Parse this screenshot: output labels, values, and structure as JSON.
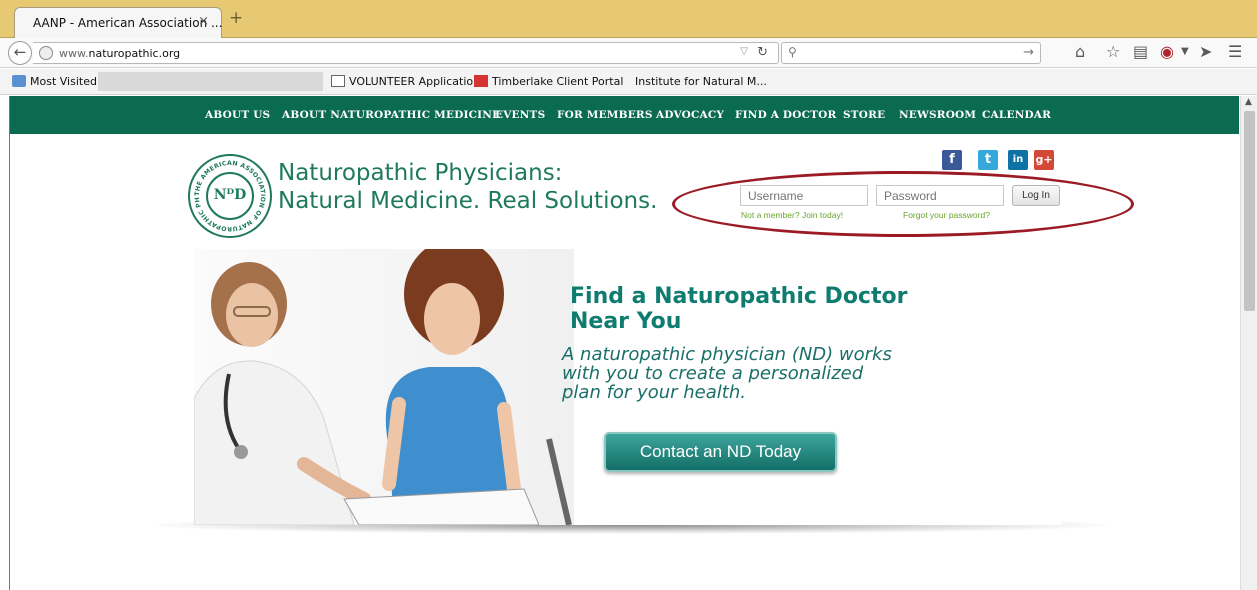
{
  "browser": {
    "tab_title": "AANP - American Association ...",
    "tab_close": "×",
    "new_tab": "+",
    "url_prefix": "www.",
    "url_host": "naturopathic.org",
    "bookmarks": [
      "Most Visited",
      "VOLUNTEER Application",
      "Timberlake Client Portal",
      "Institute for Natural M..."
    ]
  },
  "site": {
    "nav": [
      "ABOUT US",
      "ABOUT NATUROPATHIC MEDICINE",
      "EVENTS",
      "FOR MEMBERS",
      "ADVOCACY",
      "FIND A DOCTOR",
      "STORE",
      "NEWSROOM",
      "CALENDAR"
    ],
    "logo_letters": "NᴰD",
    "logo_ring_text": "THE AMERICAN ASSOCIATION OF NATUROPATHIC PHYSICIANS",
    "tagline_line1": "Naturopathic Physicians:",
    "tagline_line2": "Natural Medicine. Real Solutions.",
    "social": [
      {
        "name": "facebook",
        "glyph": "f",
        "color": "#3b5998"
      },
      {
        "name": "twitter",
        "glyph": "t",
        "color": "#34a9da"
      },
      {
        "name": "linkedin",
        "glyph": "in",
        "color": "#0f72a6"
      },
      {
        "name": "googleplus",
        "glyph": "g+",
        "color": "#d34836"
      }
    ],
    "login": {
      "username_placeholder": "Username",
      "password_placeholder": "Password",
      "login_label": "Log In",
      "join_link": "Not a member? Join today!",
      "forgot_link": "Forgot your password?"
    },
    "hero": {
      "title_line1": "Find a Naturopathic Doctor",
      "title_line2": "Near You",
      "body_line1": "A naturopathic physician (ND) works",
      "body_line2": "with you to create a personalized",
      "body_line3": "plan for your health.",
      "cta_label": "Contact an ND Today"
    }
  },
  "colors": {
    "nav_green": "#0b6b51",
    "brand_green": "#1f7a5c",
    "hero_teal": "#0f7c70",
    "link_green": "#6aa52f",
    "highlight_oval": "#9b1b25",
    "tabstrip": "#e7c873"
  }
}
